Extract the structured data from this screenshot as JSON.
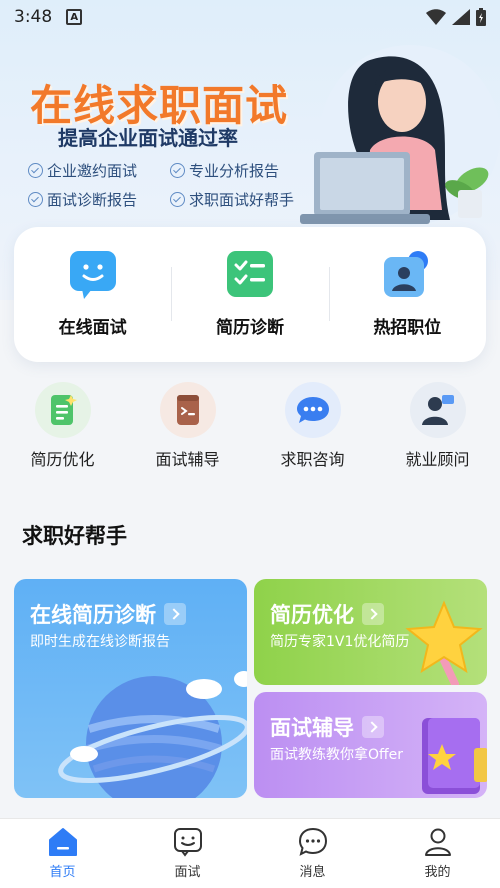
{
  "status_bar": {
    "time": "3:48",
    "notification_icon": "a-icon"
  },
  "banner": {
    "title": "在线求职面试",
    "subtitle": "提高企业面试通过率",
    "features": [
      "企业邀约面试",
      "专业分析报告",
      "面试诊断报告",
      "求职面试好帮手"
    ]
  },
  "main_services": [
    {
      "label": "在线面试",
      "icon": "chat-face-icon"
    },
    {
      "label": "简历诊断",
      "icon": "checklist-icon"
    },
    {
      "label": "热招职位",
      "icon": "recruiter-icon"
    }
  ],
  "secondary_services": [
    {
      "label": "简历优化",
      "icon": "resume-icon"
    },
    {
      "label": "面试辅导",
      "icon": "terminal-icon"
    },
    {
      "label": "求职咨询",
      "icon": "chat-bubble-icon"
    },
    {
      "label": "就业顾问",
      "icon": "advisor-icon"
    }
  ],
  "section": {
    "title": "求职好帮手"
  },
  "tiles": {
    "diagnosis": {
      "title": "在线简历诊断",
      "subtitle": "即时生成在线诊断报告"
    },
    "optimize": {
      "title": "简历优化",
      "subtitle": "简历专家1V1优化简历"
    },
    "coaching": {
      "title": "面试辅导",
      "subtitle": "面试教练教你拿Offer"
    }
  },
  "bottom_nav": [
    {
      "label": "首页",
      "icon": "home-icon",
      "active": true
    },
    {
      "label": "面试",
      "icon": "interview-icon",
      "active": false
    },
    {
      "label": "消息",
      "icon": "message-icon",
      "active": false
    },
    {
      "label": "我的",
      "icon": "profile-icon",
      "active": false
    }
  ],
  "colors": {
    "accent": "#2e7cf6",
    "banner_title": "#f2792a",
    "tile_blue": "#5aa8f2",
    "tile_green": "#8fd24a",
    "tile_purple": "#b98cf0"
  }
}
